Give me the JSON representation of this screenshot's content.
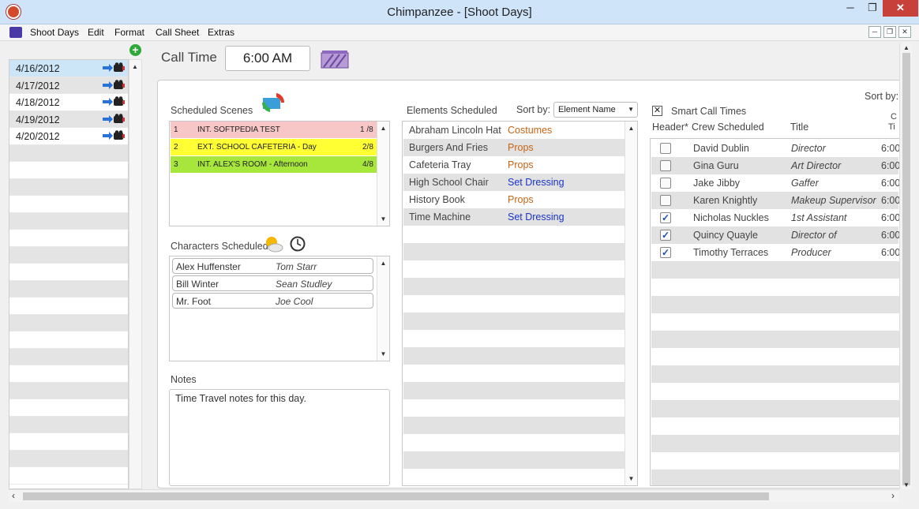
{
  "window": {
    "title": "Chimpanzee - [Shoot Days]",
    "min": "─",
    "max": "❐",
    "close": "✕"
  },
  "menu": [
    "Shoot Days",
    "Edit",
    "Format",
    "Call Sheet",
    "Extras"
  ],
  "dates": [
    "4/16/2012",
    "4/17/2012",
    "4/18/2012",
    "4/19/2012",
    "4/20/2012"
  ],
  "call_time": {
    "label": "Call Time",
    "value": "6:00 AM"
  },
  "scenes": {
    "label": "Scheduled Scenes",
    "rows": [
      {
        "num": "1",
        "name": "INT. SOFTPEDIA TEST",
        "pages": "1 /8",
        "color": "#f7c6c6"
      },
      {
        "num": "2",
        "name": "EXT. SCHOOL CAFETERIA - Day",
        "pages": "2/8",
        "color": "#ffff33"
      },
      {
        "num": "3",
        "name": "INT. ALEX'S ROOM - Afternoon",
        "pages": "4/8",
        "color": "#a7e63a"
      }
    ]
  },
  "characters": {
    "label": "Characters Scheduled",
    "rows": [
      {
        "name": "Alex Huffenster",
        "actor": "Tom Starr"
      },
      {
        "name": "Bill Winter",
        "actor": "Sean Studley"
      },
      {
        "name": "Mr. Foot",
        "actor": "Joe Cool"
      }
    ]
  },
  "notes": {
    "label": "Notes",
    "text": "Time Travel notes for this day."
  },
  "elements": {
    "label": "Elements Scheduled",
    "sort_label": "Sort by:",
    "sort_value": "Element Name",
    "rows": [
      {
        "name": "Abraham Lincoln Hat",
        "category": "Costumes",
        "color": "#c86414"
      },
      {
        "name": "Burgers And Fries",
        "category": "Props",
        "color": "#c86414"
      },
      {
        "name": "Cafeteria Tray",
        "category": "Props",
        "color": "#c86414"
      },
      {
        "name": "High School Chair",
        "category": "Set Dressing",
        "color": "#1a33c8"
      },
      {
        "name": "History Book",
        "category": "Props",
        "color": "#c86414"
      },
      {
        "name": "Time Machine",
        "category": "Set Dressing",
        "color": "#1a33c8"
      }
    ]
  },
  "crew": {
    "smart_call_label": "Smart Call Times",
    "smart_call_check": "✕",
    "sort_label": "Sort by:",
    "col_header": "Header*",
    "col_crew": "Crew Scheduled",
    "col_title": "Title",
    "col_call_1": "C",
    "col_call_2": "Ti",
    "rows": [
      {
        "name": "David Dublin",
        "title": "Director",
        "time": "6:00",
        "checked": ""
      },
      {
        "name": "Gina Guru",
        "title": "Art Director",
        "time": "6:00",
        "checked": ""
      },
      {
        "name": "Jake Jibby",
        "title": "Gaffer",
        "time": "6:00",
        "checked": ""
      },
      {
        "name": "Karen Knightly",
        "title": "Makeup Supervisor",
        "time": "6:00",
        "checked": ""
      },
      {
        "name": "Nicholas Nuckles",
        "title": "1st Assistant",
        "time": "6:00",
        "checked": "✓"
      },
      {
        "name": "Quincy Quayle",
        "title": "Director of",
        "time": "6:00",
        "checked": "✓"
      },
      {
        "name": "Timothy Terraces",
        "title": "Producer",
        "time": "6:00",
        "checked": "✓"
      }
    ]
  },
  "scroll": {
    "up": "▲",
    "down": "▼",
    "left": "‹",
    "right": "›"
  },
  "add_icon": "+"
}
